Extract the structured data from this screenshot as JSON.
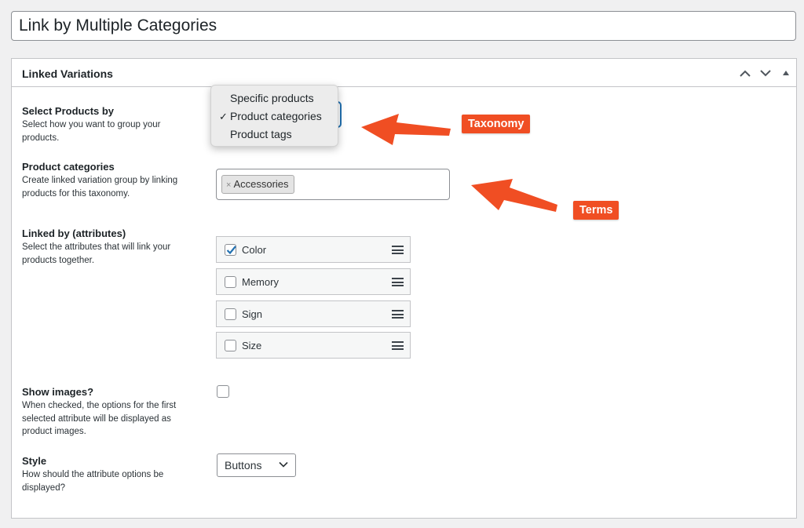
{
  "title_input": {
    "value": "Link by Multiple Categories"
  },
  "postbox": {
    "title": "Linked Variations",
    "header_buttons": [
      "move-up-icon",
      "move-down-icon",
      "toggle-panel-icon"
    ]
  },
  "fields": {
    "select_products": {
      "label": "Select Products by",
      "description": "Select how you want to group your products.",
      "options": [
        "Specific products",
        "Product categories",
        "Product tags"
      ],
      "selected": "Product categories",
      "check_mark": "✓"
    },
    "product_categories": {
      "label": "Product categories",
      "description": "Create linked variation group by linking products for this taxonomy.",
      "tokens": [
        {
          "remove": "×",
          "label": "Accessories"
        }
      ]
    },
    "linked_by": {
      "label": "Linked by (attributes)",
      "description": "Select the attributes that will link your products together.",
      "attributes": [
        {
          "label": "Color",
          "checked": true
        },
        {
          "label": "Memory",
          "checked": false
        },
        {
          "label": "Sign",
          "checked": false
        },
        {
          "label": "Size",
          "checked": false
        }
      ]
    },
    "show_images": {
      "label": "Show images?",
      "description": "When checked, the options for the first selected attribute will be displayed as product images.",
      "checked": false
    },
    "style": {
      "label": "Style",
      "description": "How should the attribute options be displayed?",
      "value": "Buttons"
    }
  },
  "annotations": {
    "taxonomy": "Taxonomy",
    "terms": "Terms",
    "color": "#f04e23"
  },
  "colors": {
    "accent": "#2271b1",
    "background": "#f0f0f1",
    "border": "#c3c4c7"
  }
}
